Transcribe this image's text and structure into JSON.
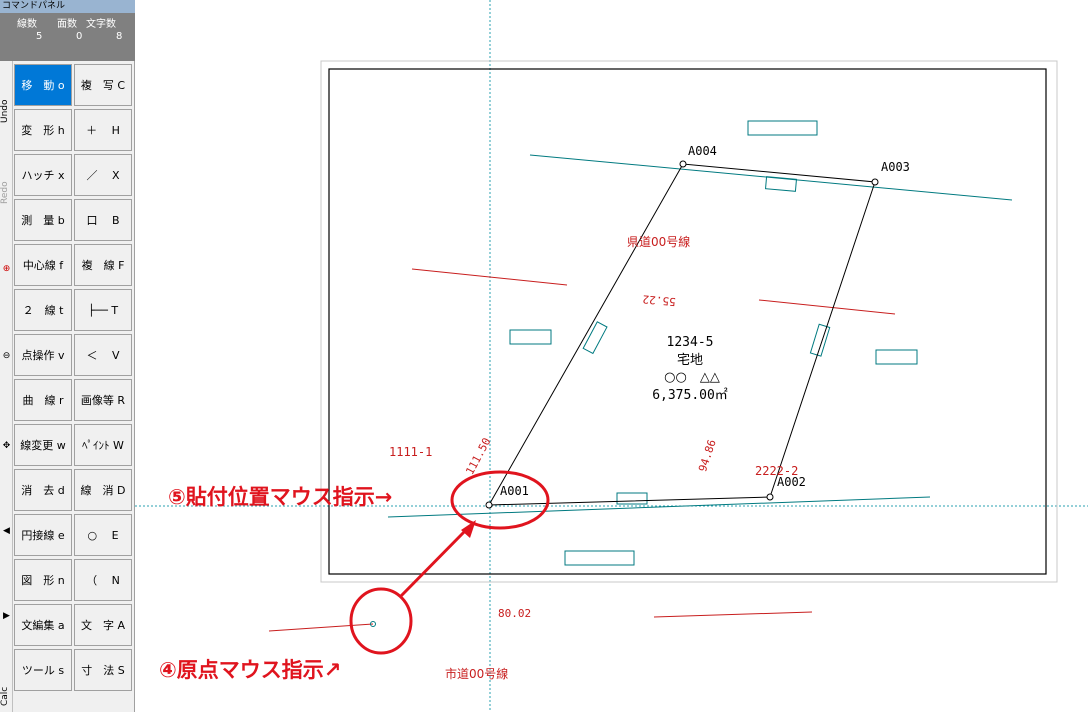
{
  "panel": {
    "title": "コマンドパネル",
    "count_headers": [
      "線数",
      "面数",
      "文字数"
    ],
    "count_values": [
      "5",
      "0",
      "8"
    ],
    "side_labels": {
      "undo": "Undo",
      "redo": "Redo",
      "calc": "Calc"
    },
    "commands": [
      {
        "left": "移　動 o",
        "right": "複　写 C"
      },
      {
        "left": "変　形 h",
        "right": "＋　 H"
      },
      {
        "left": "ハッチ x",
        "right": "／　 X"
      },
      {
        "left": "測　量 b",
        "right": "口　 B"
      },
      {
        "left": "中心線 f",
        "right": "複　線 F"
      },
      {
        "left": "２　線 t",
        "right": "├── T"
      },
      {
        "left": "点操作 v",
        "right": "＜　 V"
      },
      {
        "left": "曲　線 r",
        "right": "画像等 R"
      },
      {
        "left": "線変更 w",
        "right": "ﾍﾟｲﾝﾄ W"
      },
      {
        "left": "消　去 d",
        "right": "線　消 D"
      },
      {
        "left": "円接線 e",
        "right": "○　 E"
      },
      {
        "left": "図　形 n",
        "right": "（　 N"
      },
      {
        "left": "文編集 a",
        "right": "文　字 A"
      },
      {
        "left": "ツール s",
        "right": "寸　法 S"
      }
    ]
  },
  "drawing": {
    "points": {
      "a001": "A001",
      "a002": "A002",
      "a003": "A003",
      "a004": "A004"
    },
    "lot_number": "1234-5",
    "land_use": "宅地",
    "owner": "○○　△△",
    "area": "6,375.00㎡",
    "road_top": "県道00号線",
    "road_bottom": "市道00号線",
    "neighbor_left": "1111-1",
    "neighbor_right": "2222-2",
    "dim_top": "55.22",
    "dim_left": "111.50",
    "dim_right": "94.86",
    "dim_bottom": "80.02"
  },
  "annotations": {
    "step5": "⑤貼付位置マウス指示→",
    "step4": "④原点マウス指示↗"
  },
  "colors": {
    "active_button": "#0078d7",
    "annotation": "#e0141e",
    "road_line": "#007a80",
    "red_text": "#c81e1e"
  }
}
